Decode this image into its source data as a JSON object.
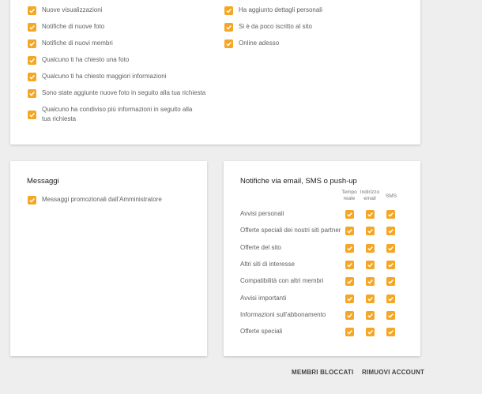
{
  "activity_card": {
    "left_items": [
      {
        "label": "Nuove visualizzazioni",
        "checked": true
      },
      {
        "label": "Notifiche di nuove foto",
        "checked": true
      },
      {
        "label": "Notifiche di nuovi membri",
        "checked": true
      },
      {
        "label": "Qualcuno ti ha chiesto una foto",
        "checked": true
      },
      {
        "label": "Qualcuno ti ha chiesto maggiori informazioni",
        "checked": true
      },
      {
        "label": "Sono state aggiunte nuove foto in seguito alla tua richiesta",
        "checked": true
      },
      {
        "label": "Qualcuno ha condiviso più informazioni in seguito alla tua richiesta",
        "checked": true
      }
    ],
    "right_items": [
      {
        "label": "Ha aggiunto dettagli personali",
        "checked": true
      },
      {
        "label": "Si è da poco iscritto al sito",
        "checked": true
      },
      {
        "label": "Online adesso",
        "checked": true
      }
    ]
  },
  "messages_card": {
    "title": "Messaggi",
    "items": [
      {
        "label": "Messaggi promozionali dall'Amministratore",
        "checked": true
      }
    ]
  },
  "notifications_card": {
    "title": "Notifiche via email, SMS o push-up",
    "col_realtime": "Tempo reale",
    "col_email": "Indirizzo email",
    "col_sms": "SMS",
    "rows": [
      {
        "label": "Avvisi personali"
      },
      {
        "label": "Offerte speciali dei nostri siti partner"
      },
      {
        "label": "Offerte del sito"
      },
      {
        "label": "Altri siti di interesse"
      },
      {
        "label": "Compatibilità con altri membri"
      },
      {
        "label": "Avvisi importanti"
      },
      {
        "label": "Informazioni sull'abbonamento"
      },
      {
        "label": "Offerte speciali"
      }
    ]
  },
  "footer": {
    "blocked_label": "MEMBRI BLOCCATI",
    "remove_label": "RIMUOVI ACCOUNT"
  },
  "colors": {
    "checkbox": "#f5a623",
    "card": "#ffffff",
    "background": "#eeeeee"
  }
}
